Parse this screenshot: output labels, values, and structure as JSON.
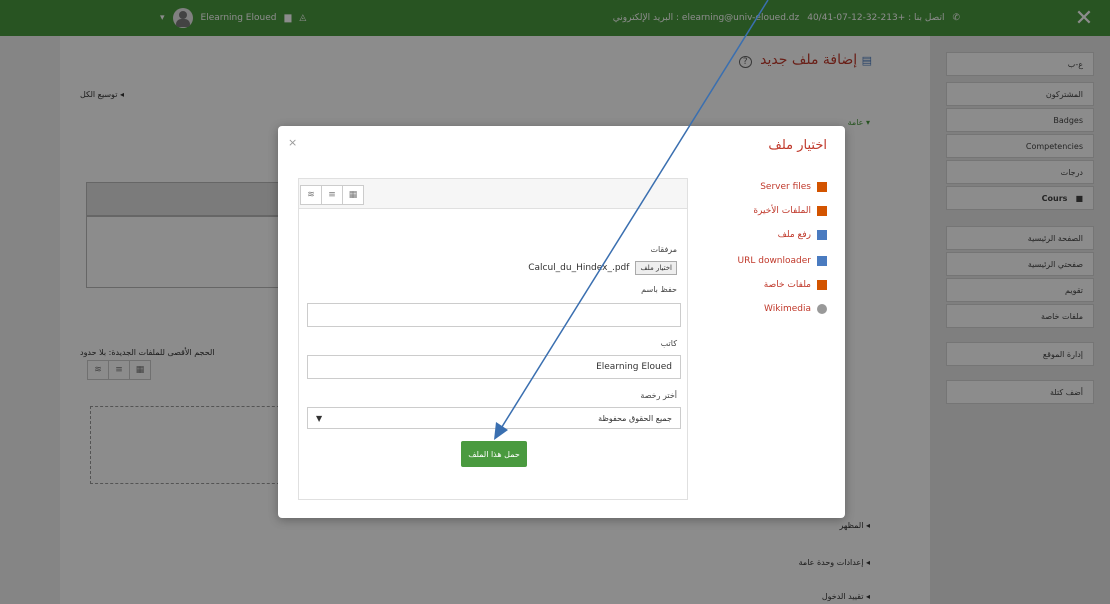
{
  "topbar": {
    "user_name": "Elearning Eloued",
    "contact": "اتصل بنا : +213-32-12-07-40/41",
    "email_label": "البريد الإلكتروني : elearning@univ-eloued.dz",
    "close_glyph": "✕",
    "chevron_glyph": "▾"
  },
  "sidebar": {
    "items": [
      "ع-ب",
      "المشتركون",
      "Badges",
      "Competencies",
      "درجات",
      "Cours",
      "الصفحة الرئيسية",
      "صفحتي الرئيسية",
      "تقويم",
      "ملفات خاصة",
      "إدارة الموقع",
      "أضف كتلة"
    ]
  },
  "main": {
    "title": "إضافة ملف جديد",
    "help_glyph": "?",
    "expand_all": "توسيع الكل",
    "section_general": "عامة",
    "max_size_label": "الحجم الأقصى للملفات الجديدة: بلا حدود",
    "section_appearance": "المظهر",
    "section_common": "إعدادات وحدة عامة",
    "section_restrict": "تقييد الدخول"
  },
  "modal": {
    "title": "اختيار ملف",
    "close_glyph": "×",
    "repos": [
      {
        "label": "Server files",
        "icon": "folder-icon"
      },
      {
        "label": "الملفات الأخيرة",
        "icon": "folder-icon"
      },
      {
        "label": "رفع ملف",
        "icon": "upload-icon"
      },
      {
        "label": "URL downloader",
        "icon": "download-icon"
      },
      {
        "label": "ملفات خاصة",
        "icon": "folder-icon"
      },
      {
        "label": "Wikimedia",
        "icon": "globe-icon"
      }
    ],
    "attachment_label": "مرفقات",
    "choose_button": "اختيار ملف",
    "chosen_file": "Calcul_du_Hindex_.pdf",
    "save_as_label": "حفظ باسم",
    "save_as_value": "",
    "author_label": "كاتب",
    "author_value": "Elearning Eloued",
    "license_label": "أختر رخصة",
    "license_value": "جميع الحقوق محفوظة",
    "upload_button": "حمل هذا الملف"
  }
}
